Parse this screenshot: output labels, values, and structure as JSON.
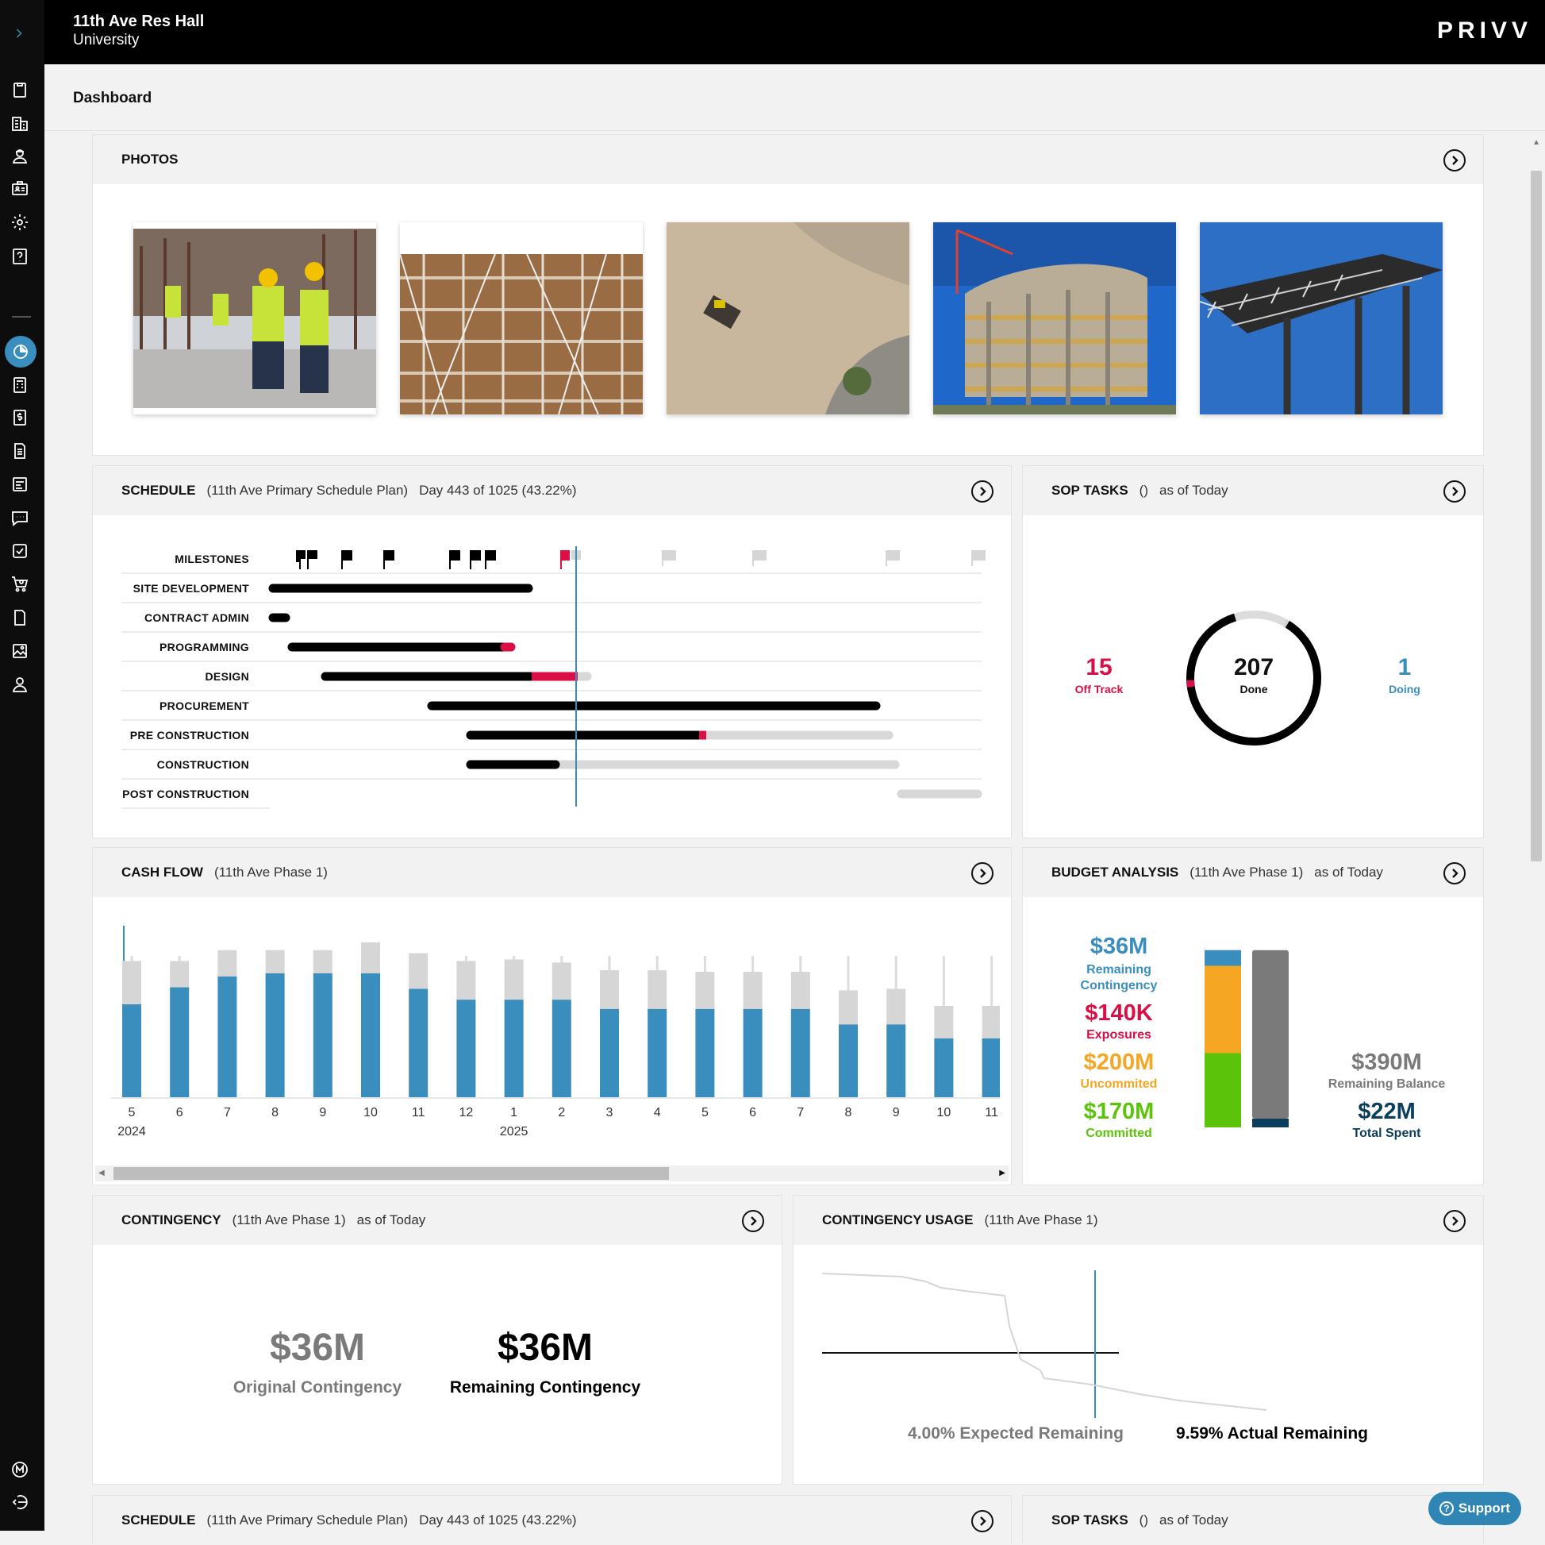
{
  "header": {
    "project_name": "11th Ave Res Hall",
    "organization": "University",
    "logo": "PRIVV",
    "page_title": "Dashboard"
  },
  "photos": {
    "title": "PHOTOS"
  },
  "schedule": {
    "title": "SCHEDULE",
    "plan": "(11th Ave Primary Schedule Plan)",
    "day": "Day 443 of 1025 (43.22%)",
    "rows": [
      "MILESTONES",
      "SITE DEVELOPMENT",
      "CONTRACT ADMIN",
      "PROGRAMMING",
      "DESIGN",
      "PROCUREMENT",
      "PRE CONSTRUCTION",
      "CONSTRUCTION",
      "POST CONSTRUCTION"
    ]
  },
  "sop": {
    "title": "SOP TASKS",
    "filter": "()",
    "asof": "as of Today",
    "off_track_value": "15",
    "off_track_label": "Off Track",
    "done_value": "207",
    "done_label": "Done",
    "doing_value": "1",
    "doing_label": "Doing"
  },
  "cashflow": {
    "title": "CASH FLOW",
    "phase": "(11th Ave Phase 1)"
  },
  "budget": {
    "title": "BUDGET ANALYSIS",
    "phase": "(11th Ave Phase 1)",
    "asof": "as of Today",
    "remaining_contingency_value": "$36M",
    "remaining_contingency_label": "Remaining Contingency",
    "exposures_value": "$140K",
    "exposures_label": "Exposures",
    "uncommitted_value": "$200M",
    "uncommitted_label": "Uncommited",
    "committed_value": "$170M",
    "committed_label": "Committed",
    "remaining_balance_value": "$390M",
    "remaining_balance_label": "Remaining Balance",
    "total_spent_value": "$22M",
    "total_spent_label": "Total Spent",
    "colors": {
      "contingency": "#3a8ebd",
      "uncommitted": "#f5a623",
      "committed": "#5bc30a",
      "balance": "#7a7a7a",
      "spent": "#0b3d5c"
    }
  },
  "contingency": {
    "title": "CONTINGENCY",
    "phase": "(11th Ave Phase 1)",
    "asof": "as of Today",
    "original_value": "$36M",
    "original_label": "Original Contingency",
    "remaining_value": "$36M",
    "remaining_label": "Remaining Contingency"
  },
  "contingency_usage": {
    "title": "CONTINGENCY USAGE",
    "phase": "(11th Ave Phase 1)",
    "expected": "4.00% Expected Remaining",
    "actual": "9.59% Actual Remaining"
  },
  "schedule2": {
    "title": "SCHEDULE",
    "plan": "(11th Ave Primary Schedule Plan)",
    "day": "Day 443 of 1025 (43.22%)"
  },
  "sop2": {
    "title": "SOP TASKS",
    "filter": "()",
    "asof": "as of Today"
  },
  "support": {
    "label": "Support"
  },
  "chart_data": [
    {
      "type": "bar",
      "title": "CASH FLOW",
      "categories": [
        "5",
        "6",
        "7",
        "8",
        "9",
        "10",
        "11",
        "12",
        "1",
        "2",
        "3",
        "4",
        "5",
        "6",
        "7",
        "8",
        "9",
        "10",
        "11"
      ],
      "year_labels": [
        {
          "at": "5",
          "label": "2024"
        },
        {
          "at": "1",
          "label": "2025"
        }
      ],
      "series": [
        {
          "values": [
            60,
            71,
            78,
            80,
            80,
            80,
            70,
            63,
            63,
            63,
            57,
            57,
            57,
            57,
            57,
            47,
            47,
            38,
            38
          ]
        },
        {
          "values": [
            28,
            17,
            17,
            15,
            15,
            20,
            23,
            25,
            26,
            24,
            25,
            25,
            24,
            24,
            24,
            22,
            23,
            21,
            21
          ]
        }
      ]
    },
    {
      "type": "bar",
      "title": "BUDGET ANALYSIS",
      "categories": [
        "Budget",
        "Spend"
      ],
      "series": [
        {
          "name": "Committed",
          "values": [
            170,
            0
          ]
        },
        {
          "name": "Uncommited",
          "values": [
            200,
            0
          ]
        },
        {
          "name": "Remaining Contingency",
          "values": [
            36,
            0
          ]
        },
        {
          "name": "Total Spent",
          "values": [
            0,
            22
          ]
        },
        {
          "name": "Remaining Balance",
          "values": [
            0,
            390
          ]
        }
      ]
    },
    {
      "type": "pie",
      "title": "SOP TASKS",
      "categories": [
        "Off Track",
        "Done",
        "Doing"
      ],
      "values": [
        15,
        207,
        1
      ]
    },
    {
      "type": "line",
      "title": "CONTINGENCY USAGE",
      "series": [
        {
          "values": [
            100,
            100,
            99,
            96,
            94,
            92,
            90,
            40,
            30,
            25,
            20,
            15,
            10,
            5
          ]
        }
      ]
    }
  ]
}
